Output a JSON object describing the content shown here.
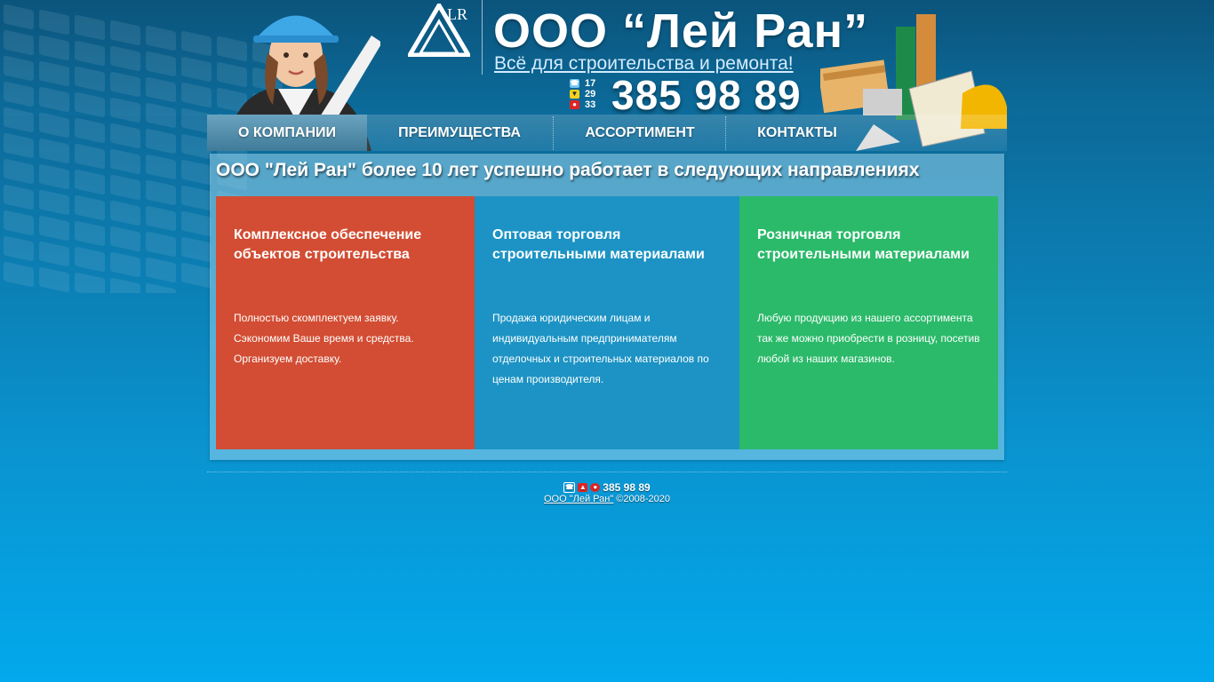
{
  "header": {
    "company_name": "ООО “Лей Ран”",
    "tagline": "Всё для строительства и ремонта!",
    "phone_codes": [
      "17",
      "29",
      "33"
    ],
    "phone": "385 98 89",
    "logo_mark": "LR"
  },
  "nav": {
    "items": [
      {
        "label": "О КОМПАНИИ",
        "active": true
      },
      {
        "label": "ПРЕИМУЩЕСТВА"
      },
      {
        "label": "АССОРТИМЕНТ"
      },
      {
        "label": "КОНТАКТЫ"
      }
    ]
  },
  "main": {
    "title": "ООО \"Лей Ран\" более 10 лет успешно работает в следующих направлениях",
    "cards": [
      {
        "title": "Комплексное обеспечение объектов строительства",
        "text": "Полностью скомплектуем заявку. Сэкономим Ваше время и средства. Организуем доставку.",
        "color": "#d24d33"
      },
      {
        "title": "Оптовая торговля строительными материалами",
        "text": "Продажа юридическим лицам и индивидуальным предпринимателям отделочных и строительных материалов по ценам производителя.",
        "color": "#1c93c4"
      },
      {
        "title": "Розничная торговля строительными материалами",
        "text": "Любую продукцию из нашего ассортимента так же можно приобрести в розницу, посетив любой из наших магазинов.",
        "color": "#2bba6a"
      }
    ]
  },
  "footer": {
    "phone": "385 98 89",
    "company_link": "ООО \"Лей Ран\"",
    "copyright": "©2008-2020"
  }
}
